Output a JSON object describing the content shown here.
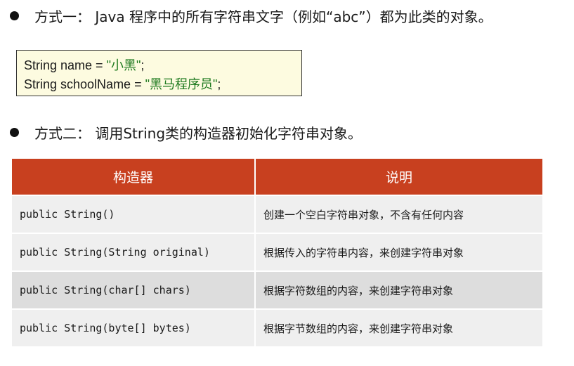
{
  "bullets": [
    "方式一：  Java 程序中的所有字符串文字（例如“abc”）都为此类的对象。",
    "方式二：  调用String类的构造器初始化字符串对象。"
  ],
  "code": [
    {
      "prefix": "String name = ",
      "literal": "\"小黑\"",
      "suffix": ";"
    },
    {
      "prefix": "String schoolName = ",
      "literal": "\"黑马程序员\"",
      "suffix": ";"
    }
  ],
  "table": {
    "headers": [
      "构造器",
      "说明"
    ],
    "rows": [
      {
        "constructor": "public String()",
        "description": "创建一个空白字符串对象，不含有任何内容"
      },
      {
        "constructor": "public String(String original)",
        "description": "根据传入的字符串内容，来创建字符串对象"
      },
      {
        "constructor": "public String(char[] chars)",
        "description": "根据字符数组的内容，来创建字符串对象"
      },
      {
        "constructor": "public String(byte[] bytes)",
        "description": "根据字节数组的内容，来创建字符串对象"
      }
    ]
  },
  "colors": {
    "header_background": "#c8401f",
    "code_box_background": "#fdfbe0",
    "string_literal": "#1f7a1f",
    "row_light": "#efefef",
    "row_dark": "#dddddd"
  }
}
